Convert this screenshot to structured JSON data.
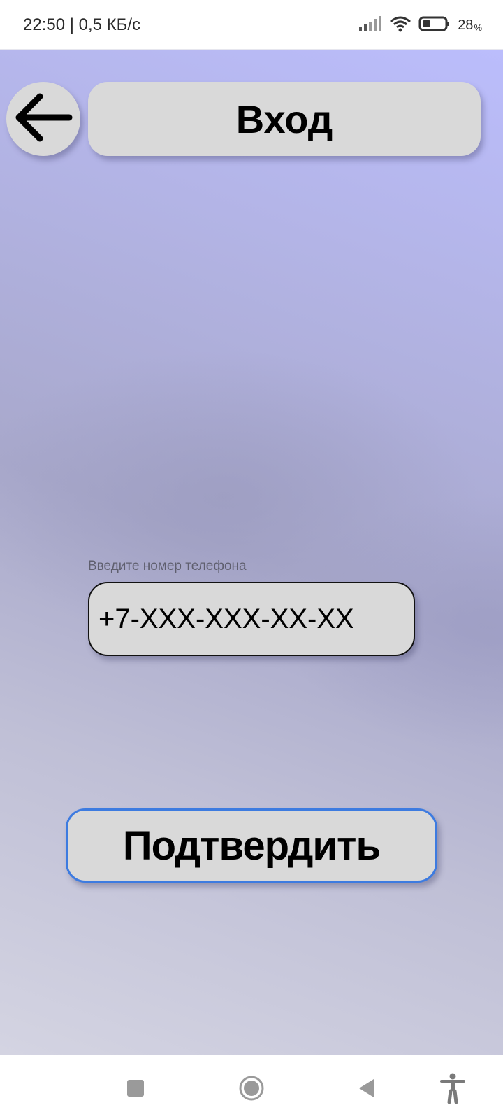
{
  "status_bar": {
    "time_speed": "22:50 | 0,5 КБ/с",
    "battery_percent": "28",
    "icons": [
      "signal-icon",
      "wifi-icon",
      "battery-icon"
    ]
  },
  "header": {
    "back_icon": "arrow-left-icon",
    "title": "Вход"
  },
  "form": {
    "phone_label": "Введите номер телефона",
    "phone_placeholder": "+7-XXX-XXX-XX-XX",
    "confirm_label": "Подтвердить"
  },
  "nav_bar": {
    "icons": [
      "recents-square-icon",
      "home-circle-icon",
      "back-triangle-icon",
      "accessibility-icon"
    ]
  },
  "colors": {
    "accent_border": "#3d7be0",
    "button_fill": "#d9d9d9",
    "background_top": "#bbbdfc",
    "background_bottom": "#d4d4e2"
  }
}
